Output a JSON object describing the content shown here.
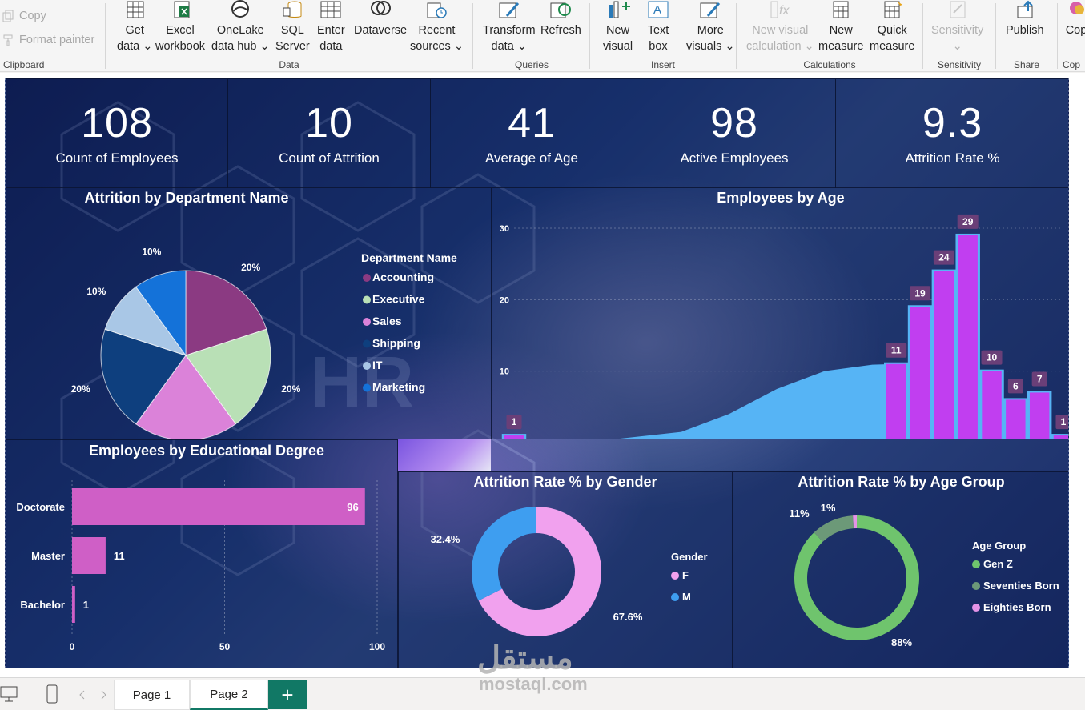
{
  "ribbon": {
    "clipboard": {
      "copy": "Copy",
      "format_painter": "Format painter",
      "label": "Clipboard"
    },
    "data": {
      "label": "Data",
      "get_data": [
        "Get",
        "data"
      ],
      "excel": [
        "Excel",
        "workbook"
      ],
      "onelake": [
        "OneLake",
        "data hub"
      ],
      "sql": [
        "SQL",
        "Server"
      ],
      "enter": [
        "Enter",
        "data"
      ],
      "dataverse": [
        "Dataverse",
        ""
      ],
      "recent": [
        "Recent",
        "sources"
      ]
    },
    "queries": {
      "label": "Queries",
      "transform": [
        "Transform",
        "data"
      ],
      "refresh": [
        "Refresh",
        ""
      ]
    },
    "insert": {
      "label": "Insert",
      "new_visual": [
        "New",
        "visual"
      ],
      "text_box": [
        "Text",
        "box"
      ],
      "more_visuals": [
        "More",
        "visuals"
      ]
    },
    "calculations": {
      "label": "Calculations",
      "new_visual_calc": [
        "New visual",
        "calculation"
      ],
      "new_measure": [
        "New",
        "measure"
      ],
      "quick_measure": [
        "Quick",
        "measure"
      ]
    },
    "sensitivity": {
      "label": "Sensitivity",
      "button": "Sensitivity"
    },
    "share": {
      "label": "Share",
      "publish": "Publish"
    },
    "copilot": {
      "label": "Cop",
      "button": "Cop"
    },
    "dropdown_glyph": "⌄"
  },
  "kpis": [
    {
      "value": "108",
      "label": "Count of Employees"
    },
    {
      "value": "10",
      "label": "Count of Attrition"
    },
    {
      "value": "41",
      "label": "Average of Age"
    },
    {
      "value": "98",
      "label": "Active Employees"
    },
    {
      "value": "9.3",
      "label": "Attrition Rate %"
    }
  ],
  "colors": {
    "accounting": "#8b3a82",
    "executive": "#b9e0b6",
    "sales": "#db82d9",
    "shipping": "#0e3f7e",
    "it": "#a9c7e6",
    "marketing": "#1472d9",
    "bar_purple": "#c13ef0",
    "area_blue": "#56b4f5",
    "edu_bar": "#cf5fc6",
    "female": "#f1a1ee",
    "male": "#3e9ef0",
    "genz": "#6fc46d",
    "seventies": "#6c9978",
    "eighties": "#e493e7",
    "label_bg": "#6a3f78"
  },
  "chart_data": [
    {
      "type": "pie",
      "title": "Attrition by Department Name",
      "legend_title": "Department Name",
      "legend_position": "right",
      "slices": [
        {
          "name": "Accounting",
          "value": 20,
          "label": "20%"
        },
        {
          "name": "Executive",
          "value": 20,
          "label": "20%"
        },
        {
          "name": "Sales",
          "value": 20,
          "label": "20%"
        },
        {
          "name": "Shipping",
          "value": 20,
          "label": "20%"
        },
        {
          "name": "IT",
          "value": 10,
          "label": "10%"
        },
        {
          "name": "Marketing",
          "value": 10,
          "label": "10%"
        }
      ]
    },
    {
      "type": "bar",
      "title": "Employees by Age",
      "ylim": [
        0,
        30
      ],
      "xlim": [
        23,
        46
      ],
      "yticks": [
        "0",
        "10",
        "20",
        "30"
      ],
      "xticks": [
        "25",
        "30",
        "35",
        "40",
        "45"
      ],
      "x": [
        23,
        39,
        40,
        41,
        42,
        43,
        44,
        45,
        46
      ],
      "values": [
        1,
        11,
        19,
        24,
        29,
        10,
        6,
        7,
        1
      ],
      "labels": [
        "1",
        "11",
        "19",
        "24",
        "29",
        "10",
        "6",
        "7",
        "1"
      ],
      "area_curve": {
        "x": [
          23,
          27,
          30,
          32,
          34,
          36,
          38,
          39
        ],
        "y": [
          0,
          0.4,
          1.5,
          4,
          7.5,
          10,
          10.9,
          11
        ]
      }
    },
    {
      "type": "bar",
      "orientation": "horizontal",
      "title": "Employees by Educational Degree",
      "categories": [
        "Doctorate",
        "Master",
        "Bachelor"
      ],
      "values": [
        96,
        11,
        1
      ],
      "labels": [
        "96",
        "11",
        "1"
      ],
      "xlim": [
        0,
        100
      ],
      "xticks": [
        "0",
        "50",
        "100"
      ]
    },
    {
      "type": "pie",
      "subtype": "donut",
      "title": "Attrition Rate % by Gender",
      "legend_title": "Gender",
      "slices": [
        {
          "name": "F",
          "value": 67.6,
          "label": "67.6%"
        },
        {
          "name": "M",
          "value": 32.4,
          "label": "32.4%"
        }
      ]
    },
    {
      "type": "pie",
      "subtype": "donut",
      "title": "Attrition Rate % by Age Group",
      "legend_title": "Age Group",
      "slices": [
        {
          "name": "Gen Z",
          "value": 88,
          "label": "88%"
        },
        {
          "name": "Seventies Born",
          "value": 11,
          "label": "11%"
        },
        {
          "name": "Eighties Born",
          "value": 1,
          "label": "1%"
        }
      ]
    }
  ],
  "tabs": {
    "page1": "Page 1",
    "page2": "Page 2",
    "add": "+"
  },
  "watermark": {
    "arabic": "مستقل",
    "latin": "mostaql.com"
  }
}
